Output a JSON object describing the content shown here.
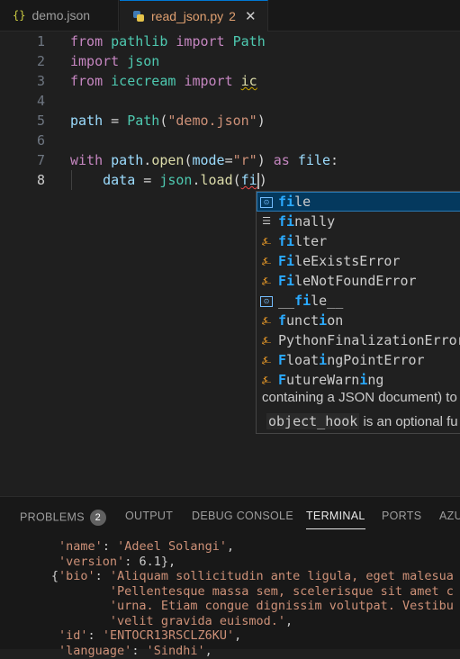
{
  "tabs": [
    {
      "icon": "json-braces-icon",
      "braces": "{}",
      "label": "demo.json"
    },
    {
      "icon": "python-icon",
      "label": "read_json.py",
      "badge": "2",
      "close": "✕"
    }
  ],
  "editor": {
    "line_numbers": [
      "1",
      "2",
      "3",
      "4",
      "5",
      "6",
      "7",
      "8"
    ],
    "lines": [
      [
        {
          "t": "from",
          "c": "kw"
        },
        {
          "t": " ",
          "c": "plain"
        },
        {
          "t": "pathlib",
          "c": "mod"
        },
        {
          "t": " ",
          "c": "plain"
        },
        {
          "t": "import",
          "c": "kw"
        },
        {
          "t": " ",
          "c": "plain"
        },
        {
          "t": "Path",
          "c": "cls"
        }
      ],
      [
        {
          "t": "import",
          "c": "kw"
        },
        {
          "t": " ",
          "c": "plain"
        },
        {
          "t": "json",
          "c": "mod"
        }
      ],
      [
        {
          "t": "from",
          "c": "kw"
        },
        {
          "t": " ",
          "c": "plain"
        },
        {
          "t": "icecream",
          "c": "mod"
        },
        {
          "t": " ",
          "c": "plain"
        },
        {
          "t": "import",
          "c": "kw"
        },
        {
          "t": " ",
          "c": "plain"
        },
        {
          "t": "ic",
          "c": "fn squig-y"
        }
      ],
      [],
      [
        {
          "t": "path",
          "c": "var"
        },
        {
          "t": " = ",
          "c": "plain"
        },
        {
          "t": "Path",
          "c": "cls"
        },
        {
          "t": "(",
          "c": "plain"
        },
        {
          "t": "\"demo.json\"",
          "c": "str"
        },
        {
          "t": ")",
          "c": "plain"
        }
      ],
      [],
      [
        {
          "t": "with",
          "c": "kw"
        },
        {
          "t": " ",
          "c": "plain"
        },
        {
          "t": "path",
          "c": "var"
        },
        {
          "t": ".",
          "c": "plain"
        },
        {
          "t": "open",
          "c": "fn"
        },
        {
          "t": "(",
          "c": "plain"
        },
        {
          "t": "mode",
          "c": "prm"
        },
        {
          "t": "=",
          "c": "plain"
        },
        {
          "t": "\"r\"",
          "c": "str"
        },
        {
          "t": ") ",
          "c": "plain"
        },
        {
          "t": "as",
          "c": "kw"
        },
        {
          "t": " ",
          "c": "plain"
        },
        {
          "t": "file",
          "c": "var"
        },
        {
          "t": ":",
          "c": "plain"
        }
      ],
      [
        {
          "t": "    ",
          "c": "plain"
        },
        {
          "t": "data",
          "c": "var"
        },
        {
          "t": " = ",
          "c": "plain"
        },
        {
          "t": "json",
          "c": "mod"
        },
        {
          "t": ".",
          "c": "plain"
        },
        {
          "t": "load",
          "c": "fn"
        },
        {
          "t": "(",
          "c": "plain"
        },
        {
          "t": "fi",
          "c": "var squig"
        },
        {
          "t": "|",
          "c": "cursor"
        },
        {
          "t": ")",
          "c": "plain"
        }
      ]
    ],
    "active_line": "8"
  },
  "suggestions": [
    {
      "icon": "variable-icon",
      "glyph": "[⊙]",
      "parts": [
        [
          "fi",
          true
        ],
        [
          "le",
          false
        ]
      ]
    },
    {
      "icon": "keyword-icon",
      "glyph": "☰",
      "parts": [
        [
          "fi",
          true
        ],
        [
          "nally",
          false
        ]
      ]
    },
    {
      "icon": "class-icon",
      "glyph": "⍼",
      "parts": [
        [
          "fi",
          true
        ],
        [
          "lter",
          false
        ]
      ]
    },
    {
      "icon": "class-icon",
      "glyph": "⍼",
      "parts": [
        [
          "Fi",
          true
        ],
        [
          "leExistsError",
          false
        ]
      ]
    },
    {
      "icon": "class-icon",
      "glyph": "⍼",
      "parts": [
        [
          "Fi",
          true
        ],
        [
          "leNotFoundError",
          false
        ]
      ]
    },
    {
      "icon": "variable-icon",
      "glyph": "[⊙]",
      "parts": [
        [
          "__",
          false
        ],
        [
          "fi",
          true
        ],
        [
          "le__",
          false
        ]
      ]
    },
    {
      "icon": "class-icon",
      "glyph": "⍼",
      "parts": [
        [
          "f",
          true
        ],
        [
          "unct",
          false
        ],
        [
          "i",
          true
        ],
        [
          "on",
          false
        ]
      ]
    },
    {
      "icon": "class-icon",
      "glyph": "⍼",
      "parts": [
        [
          "PythonFi",
          false
        ],
        [
          "nalizationError",
          false
        ]
      ]
    },
    {
      "icon": "class-icon",
      "glyph": "⍼",
      "parts": [
        [
          "F",
          true
        ],
        [
          "loat",
          false
        ],
        [
          "i",
          true
        ],
        [
          "ngPointError",
          false
        ]
      ]
    },
    {
      "icon": "class-icon",
      "glyph": "⍼",
      "parts": [
        [
          "F",
          true
        ],
        [
          "utureWarn",
          false
        ],
        [
          "i",
          true
        ],
        [
          "ng",
          false
        ]
      ]
    }
  ],
  "doc": {
    "line1": "containing a JSON document) to",
    "hook": "object_hook",
    "line2_rest": " is an optional fu"
  },
  "panel": {
    "tabs": [
      {
        "label": "PROBLEMS",
        "count": "2"
      },
      {
        "label": "OUTPUT"
      },
      {
        "label": "DEBUG CONSOLE"
      },
      {
        "label": "TERMINAL",
        "active": true
      },
      {
        "label": "PORTS"
      },
      {
        "label": "AZU"
      }
    ],
    "terminal_lines": [
      "        'name': 'Adeel Solangi',",
      "        'version': 6.1},",
      "       {'bio': 'Aliquam sollicitudin ante ligula, eget malesua",
      "               'Pellentesque massa sem, scelerisque sit amet c",
      "               'urna. Etiam congue dignissim volutpat. Vestibu",
      "               'velit gravida euismod.',",
      "        'id': 'ENTOCR13RSCLZ6KU',",
      "        'language': 'Sindhi',"
    ]
  }
}
